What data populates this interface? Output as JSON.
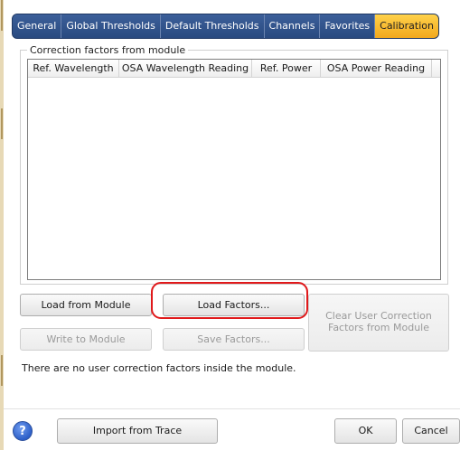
{
  "tabs": [
    {
      "label": "General",
      "active": false
    },
    {
      "label": "Global Thresholds",
      "active": false
    },
    {
      "label": "Default Thresholds",
      "active": false
    },
    {
      "label": "Channels",
      "active": false
    },
    {
      "label": "Favorites",
      "active": false
    },
    {
      "label": "Calibration",
      "active": true
    }
  ],
  "group": {
    "title": "Correction factors from module",
    "columns": [
      "Ref. Wavelength",
      "OSA Wavelength Reading",
      "Ref. Power",
      "OSA Power Reading"
    ]
  },
  "buttons": {
    "load_from_module": "Load from Module",
    "load_factors": "Load Factors...",
    "clear_user_factors": "Clear User Correction Factors from Module",
    "write_to_module": "Write to Module",
    "save_factors": "Save Factors...",
    "import_from_trace": "Import from Trace",
    "ok": "OK",
    "cancel": "Cancel"
  },
  "status": "There are no user correction factors inside the module.",
  "icons": {
    "help": "help-icon"
  },
  "colors": {
    "active_tab": "#f7b42b",
    "tab_bar": "#2b4a7f",
    "highlight": "#e0191b"
  }
}
